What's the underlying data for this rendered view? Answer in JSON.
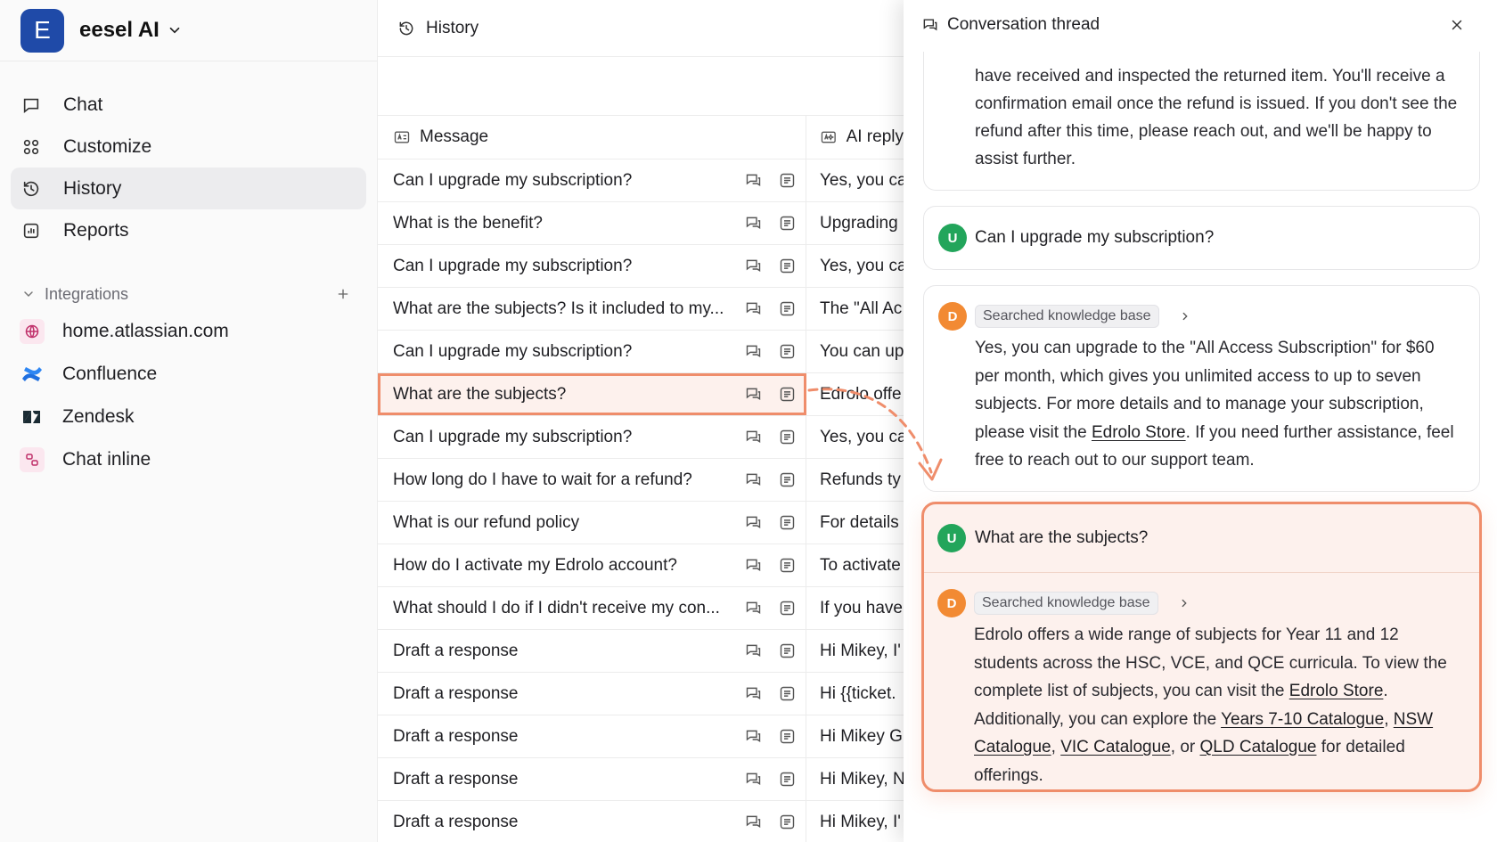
{
  "brand": {
    "initial": "E",
    "name": "eesel AI"
  },
  "nav": [
    {
      "label": "Chat",
      "icon": "chat-icon"
    },
    {
      "label": "Customize",
      "icon": "customize-icon"
    },
    {
      "label": "History",
      "icon": "history-icon",
      "active": true
    },
    {
      "label": "Reports",
      "icon": "reports-icon"
    }
  ],
  "integrations": {
    "heading": "Integrations",
    "items": [
      {
        "label": "home.atlassian.com",
        "icon": "globe-icon"
      },
      {
        "label": "Confluence",
        "icon": "confluence-icon"
      },
      {
        "label": "Zendesk",
        "icon": "zendesk-icon"
      },
      {
        "label": "Chat inline",
        "icon": "chat-inline-icon"
      }
    ]
  },
  "history": {
    "title": "History",
    "columns": {
      "message": "Message",
      "ai_reply": "AI reply"
    },
    "rows": [
      {
        "message": "Can I upgrade my subscription?",
        "reply": "Yes, you ca"
      },
      {
        "message": "What is the benefit?",
        "reply": "Upgrading"
      },
      {
        "message": "Can I upgrade my subscription?",
        "reply": "Yes, you ca"
      },
      {
        "message": "What are the subjects? Is it included to my...",
        "reply": "The \"All Ac"
      },
      {
        "message": "Can I upgrade my subscription?",
        "reply": "You can up"
      },
      {
        "message": "What are the subjects?",
        "reply": "Edrolo offe",
        "selected": true
      },
      {
        "message": "Can I upgrade my subscription?",
        "reply": "Yes, you ca"
      },
      {
        "message": "How long do I have to wait for a refund?",
        "reply": "Refunds ty"
      },
      {
        "message": "What is our refund policy",
        "reply": "For details"
      },
      {
        "message": "How do I activate my Edrolo account?",
        "reply": "To activate"
      },
      {
        "message": "What should I do if I didn't receive my con...",
        "reply": "If you have"
      },
      {
        "message": "Draft a response",
        "reply": "Hi Mikey, I'"
      },
      {
        "message": "Draft a response",
        "reply": "Hi {{ticket."
      },
      {
        "message": "Draft a response",
        "reply": "Hi Mikey G"
      },
      {
        "message": "Draft a response",
        "reply": "Hi Mikey, N"
      },
      {
        "message": "Draft a response",
        "reply": "Hi Mikey, I'"
      }
    ]
  },
  "thread": {
    "title": "Conversation thread",
    "prev_reply_tail": "have received and inspected the returned item. You'll receive a confirmation email once the refund is issued. If you don't see the refund after this time, please reach out, and we'll be happy to assist further.",
    "q1": {
      "avatar": "U",
      "text": "Can I upgrade my subscription?"
    },
    "a1": {
      "avatar": "D",
      "tool": "Searched knowledge base",
      "text_before": "Yes, you can upgrade to the \"All Access Subscription\" for $60 per month, which gives you unlimited access to up to seven subjects. For more details and to manage your subscription, please visit the ",
      "link": "Edrolo Store",
      "text_after": ". If you need further assistance, feel free to reach out to our support team."
    },
    "q2": {
      "avatar": "U",
      "text": "What are the subjects?"
    },
    "a2": {
      "avatar": "D",
      "tool": "Searched knowledge base",
      "t1": "Edrolo offers a wide range of subjects for Year 11 and 12 students across the HSC, VCE, and QCE curricula. To view the complete list of subjects, you can visit the ",
      "l1": "Edrolo Store",
      "t2": ". Additionally, you can explore the ",
      "l2": "Years 7-10 Catalogue",
      "t3": ", ",
      "l3": "NSW Catalogue",
      "t4": ", ",
      "l4": "VIC Catalogue",
      "t5": ", or ",
      "l5": "QLD Catalogue",
      "t6": " for detailed offerings."
    }
  },
  "colors": {
    "brand": "#1f4aa8",
    "highlight": "#ef8d6b",
    "user_avatar": "#22a55b",
    "bot_avatar": "#f28a33"
  }
}
